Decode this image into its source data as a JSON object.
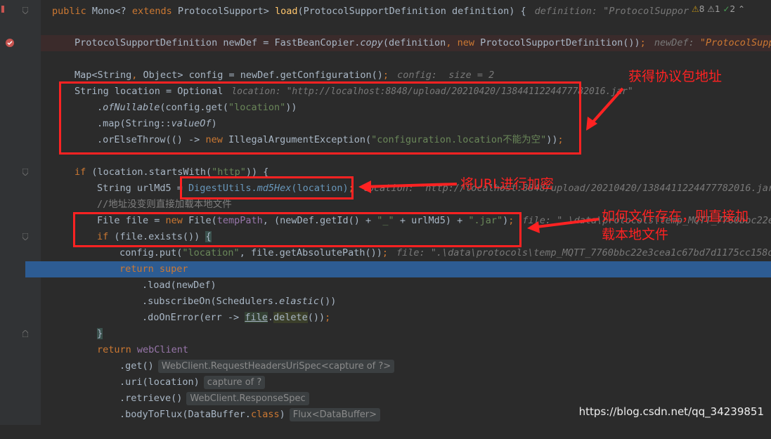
{
  "editor": {
    "lines": {
      "l1": {
        "a": "public ",
        "b": "Mono<? ",
        "c": "extends ",
        "d": "ProtocolSupport> ",
        "e": "load",
        "f": "(ProtocolSupportDefinition definition) {",
        "hint": "definition: \"ProtocolSuppor"
      },
      "l2": {
        "a": "ProtocolSupportDefinition newDef = FastBeanCopier.",
        "b": "copy",
        "c": "(definition",
        "d": ", ",
        "e": "new ",
        "f": "ProtocolSupportDefinition())",
        "g": ";",
        "hint": "newDef: ",
        "hint2": "\"ProtocolSuppo"
      },
      "l3": {
        "a": "Map<String",
        "b": ", ",
        "c": "Object> config = newDef.getConfiguration()",
        "d": ";",
        "hint": "config:  size = 2"
      },
      "l4": {
        "a": "String location = Optional",
        "hint": "location: \"http://localhost:8848/upload/20210420/1384411224477782016.jar\""
      },
      "l5": {
        "a": ".",
        "b": "ofNullable",
        "c": "(config.get(",
        "d": "\"location\"",
        "e": "))"
      },
      "l6": {
        "a": ".map(String::",
        "b": "valueOf",
        "c": ")"
      },
      "l7": {
        "a": ".orElseThrow(() -> ",
        "b": "new ",
        "c": "IllegalArgumentException(",
        "d": "\"configuration.location不能为空\"",
        "e": "))",
        "f": ";"
      },
      "l8": {
        "a": "if ",
        "b": "(location.startsWith(",
        "c": "\"http\"",
        "d": ")) {"
      },
      "l9": {
        "a": "String urlMd5 = ",
        "b": "DigestUtils.",
        "c": "md5Hex",
        "d": "(location)",
        "e": ";",
        "hint": "location: \"http://localhost:8848/upload/20210420/1384411224477782016.jar"
      },
      "l10": {
        "a": "//地址没变则直接加载本地文件"
      },
      "l11": {
        "a": "File file = ",
        "b": "new ",
        "c": "File(",
        "d": "tempPath",
        "e": ", (newDef.getId() + ",
        "f": "\"_\"",
        "g": " + urlMd5) + ",
        "h": "\".jar\"",
        "i": ")",
        "j": ";",
        "hint": "file: \".\\data\\protocols\\temp_MQTT_7760bbc22e3"
      },
      "l12": {
        "a": "if ",
        "b": "(file.exists()) ",
        "c": "{"
      },
      "l13": {
        "a": "config.put(",
        "b": "\"location\"",
        "c": ", file.getAbsolutePath())",
        "d": ";",
        "hint": "file: \".\\data\\protocols\\temp_MQTT_7760bbc22e3cea1c67bd7d1175cc158d1"
      },
      "l14": {
        "a": "return super"
      },
      "l15": {
        "a": ".load(newDef)"
      },
      "l16": {
        "a": ".subscribeOn(Schedulers.",
        "b": "elastic",
        "c": "())"
      },
      "l17": {
        "a": ".doOnError(err -> ",
        "b": "file",
        "c": ".",
        "d": "delete",
        "e": "())",
        "f": ";"
      },
      "l18": {
        "a": "}"
      },
      "l19": {
        "a": "return ",
        "b": "webClient"
      },
      "l20": {
        "a": ".get()",
        "inlay": "WebClient.RequestHeadersUriSpec<capture of ?>"
      },
      "l21": {
        "a": ".uri(location)",
        "inlay": "capture of ?"
      },
      "l22": {
        "a": ".retrieve()",
        "inlay": "WebClient.ResponseSpec"
      },
      "l23": {
        "a": ".bodyToFlux(DataBuffer.",
        "b": "class",
        "c": ")",
        "inlay": "Flux<DataBuffer>"
      }
    }
  },
  "inspections": {
    "warnings": "8",
    "weak": "1",
    "ok": "2"
  },
  "annotations": {
    "a1": "获得协议包地址",
    "a2": "将URL进行加密",
    "a3_line1": "如何文件存在，则直接加",
    "a3_line2": "载本地文件"
  },
  "watermark": "https://blog.csdn.net/qq_34239851",
  "colors": {
    "keyword": "#cc7832",
    "string": "#6a8759",
    "selection": "#2d5c93",
    "annotation": "#ff2222"
  }
}
